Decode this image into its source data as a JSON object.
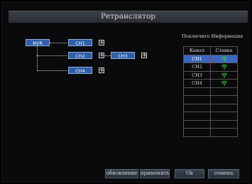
{
  "window": {
    "title": "Ретранслятор"
  },
  "tree": {
    "root": "NVR",
    "nodes": [
      {
        "label": "CH1"
      },
      {
        "label": "CH2"
      },
      {
        "label": "CH3"
      },
      {
        "label": "CH4"
      }
    ],
    "plus_symbol": "+"
  },
  "info": {
    "title": "Поключите Информация",
    "columns": [
      "Канал",
      "Ставка"
    ],
    "rows": [
      {
        "channel": "CH1",
        "signal_icon": "wifi-icon",
        "selected": true
      },
      {
        "channel": "CH2",
        "signal_icon": "wifi-icon",
        "selected": false
      },
      {
        "channel": "CH3",
        "signal_icon": "wifi-icon",
        "selected": false
      },
      {
        "channel": "CH4",
        "signal_icon": "wifi-icon",
        "selected": false
      }
    ],
    "empty_rows": 6,
    "signal_color": "#39d23a",
    "selected_color": "#3c66c0"
  },
  "buttons": {
    "refresh": "обновление",
    "apply": "применить",
    "ok": "Ok",
    "cancel": "отмена"
  }
}
